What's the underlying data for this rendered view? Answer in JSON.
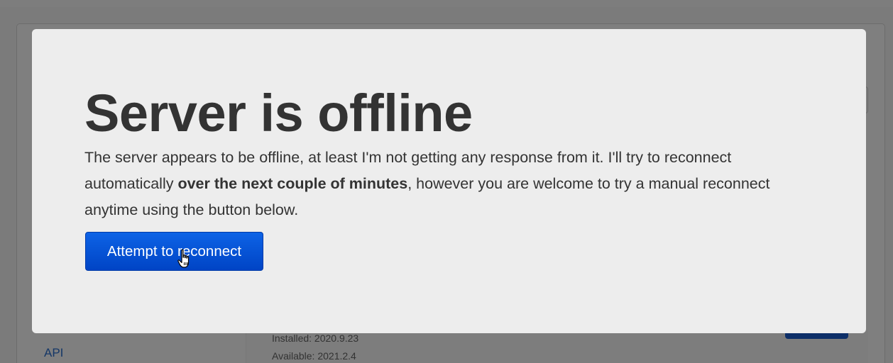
{
  "background": {
    "api_link": "API",
    "installed": "Installed: 2020.9.23",
    "available": "Available: 2021.2.4"
  },
  "modal": {
    "title": "Server is offline",
    "message_part1": "The server appears to be offline, at least I'm not getting any response from it. I'll try to reconnect automatically ",
    "message_bold": "over the next couple of minutes",
    "message_part2": ", however you are welcome to try a manual reconnect anytime using the button below.",
    "reconnect_button": "Attempt to reconnect"
  },
  "colors": {
    "accent": "#0050d8",
    "modal_background": "#ededed",
    "text": "#333333",
    "overlay": "rgba(0,0,0,0.5)"
  },
  "icons": {
    "cursor": "hand-pointer-icon",
    "close": "close-icon"
  }
}
